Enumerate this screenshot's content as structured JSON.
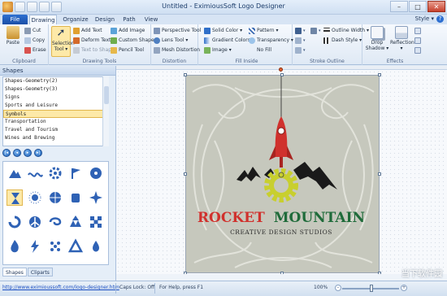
{
  "window": {
    "title": "Untitled - EximiousSoft Logo Designer",
    "controls": [
      "–",
      "□",
      "✕"
    ]
  },
  "tabs": {
    "file": "File",
    "items": [
      "Drawing",
      "Organize",
      "Design",
      "Path",
      "View"
    ],
    "active": "Drawing",
    "style_menu": "Style ▾",
    "help": "?"
  },
  "ribbon": {
    "clipboard": {
      "label": "Clipboard",
      "paste": "Paste",
      "cut": "Cut",
      "copy": "Copy",
      "erase": "Erase"
    },
    "drawing_tools": {
      "label": "Drawing Tools",
      "selection_tool": "Selection Tool ▾",
      "add_text": "Add Text",
      "deform_text": "Deform Text",
      "text_to_shape": "Text to Shape",
      "add_image": "Add Image",
      "custom_shape": "Custom Shape",
      "pencil_tool": "Pencil Tool"
    },
    "distortion": {
      "label": "Distortion",
      "perspective_tool": "Perspective Tool",
      "lens_tool": "Lens Tool ▾",
      "mesh_distortion": "Mesh Distortion"
    },
    "fill_inside": {
      "label": "Fill Inside",
      "solid_color": "Solid Color ▾",
      "gradient_colors": "Gradient Colors ▾",
      "image": "Image ▾",
      "pattern": "Pattern ▾",
      "transparency": "Transparency ▾",
      "no_fill": "No Fill"
    },
    "stroke_outline": {
      "label": "Stroke Outline",
      "outline_width": "Outline Width ▾",
      "dash_style": "Dash Style ▾"
    },
    "effects": {
      "label": "Effects",
      "drop_shadow": "Drop Shadow ▾",
      "reflection": "Reflection ▾"
    }
  },
  "shapes_panel": {
    "header": "Shapes",
    "categories": [
      "Shapes-Geometry(2)",
      "Shapes-Geometry(3)",
      "Signs",
      "Sports and Leisure",
      "Symbols",
      "Transportation",
      "Travel and Tourism",
      "Wines and Brewing"
    ],
    "selected_category": "Symbols",
    "bottom_tabs": [
      "Shapes",
      "Cliparts"
    ],
    "active_bottom_tab": "Shapes",
    "nav_icons": [
      "first-icon",
      "prev-icon",
      "next-icon",
      "last-icon"
    ]
  },
  "logo": {
    "title_part1": "ROCKET",
    "title_part2": "MOUNTAIN",
    "subtitle": "CREATIVE DESIGN STUDIOS",
    "colors": {
      "red": "#d0312d",
      "green": "#1f6b3a",
      "gear": "#c8cf2e",
      "background": "#c6c8bd"
    }
  },
  "status": {
    "url": "http://www.eximioussoft.com/logo-designer.htm",
    "caps_lock": "Caps Lock: Off",
    "help_hint": "For Help, press F1",
    "zoom": "100%"
  },
  "watermark": "当下软件园"
}
